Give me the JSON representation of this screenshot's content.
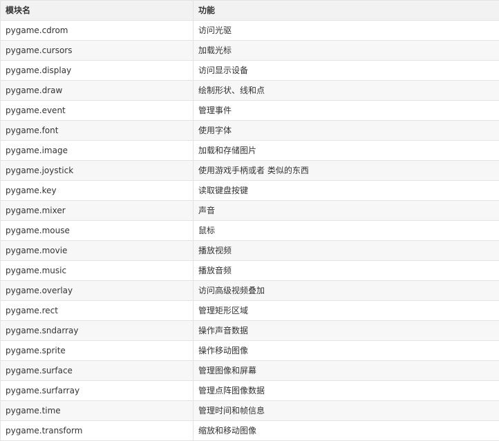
{
  "table": {
    "headers": [
      "模块名",
      "功能"
    ],
    "rows": [
      [
        "pygame.cdrom",
        "访问光驱"
      ],
      [
        "pygame.cursors",
        "加载光标"
      ],
      [
        "pygame.display",
        "访问显示设备"
      ],
      [
        "pygame.draw",
        "绘制形状、线和点"
      ],
      [
        "pygame.event",
        "管理事件"
      ],
      [
        "pygame.font",
        "使用字体"
      ],
      [
        "pygame.image",
        "加载和存储图片"
      ],
      [
        "pygame.joystick",
        "使用游戏手柄或者 类似的东西"
      ],
      [
        "pygame.key",
        "读取键盘按键"
      ],
      [
        "pygame.mixer",
        "声音"
      ],
      [
        "pygame.mouse",
        "鼠标"
      ],
      [
        "pygame.movie",
        "播放视频"
      ],
      [
        "pygame.music",
        "播放音频"
      ],
      [
        "pygame.overlay",
        "访问高级视频叠加"
      ],
      [
        "pygame.rect",
        "管理矩形区域"
      ],
      [
        "pygame.sndarray",
        "操作声音数据"
      ],
      [
        "pygame.sprite",
        "操作移动图像"
      ],
      [
        "pygame.surface",
        "管理图像和屏幕"
      ],
      [
        "pygame.surfarray",
        "管理点阵图像数据"
      ],
      [
        "pygame.time",
        "管理时间和帧信息"
      ],
      [
        "pygame.transform",
        "缩放和移动图像"
      ]
    ]
  }
}
